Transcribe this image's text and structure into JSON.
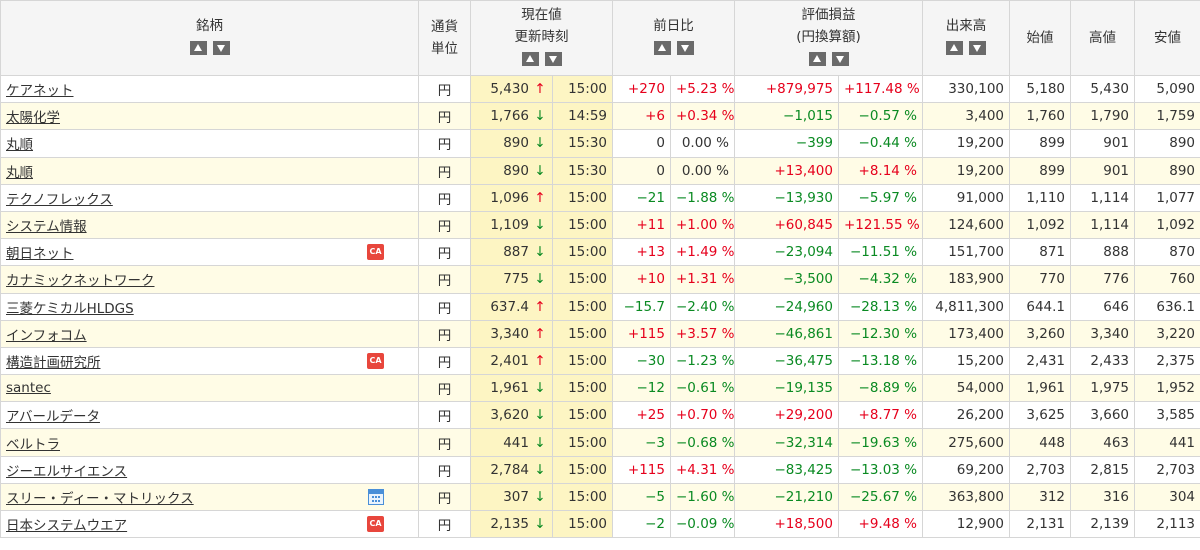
{
  "headers": {
    "name": "銘柄",
    "currency_line1": "通貨",
    "currency_line2": "単位",
    "price_line1": "現在値",
    "price_line2": "更新時刻",
    "change": "前日比",
    "pl_line1": "評価損益",
    "pl_line2": "(円換算額)",
    "volume": "出来高",
    "open": "始値",
    "high": "高値",
    "low": "安値"
  },
  "rows": [
    {
      "name": "ケアネット",
      "badge": "",
      "cur": "円",
      "price": "5,430",
      "arrow": "up",
      "time": "15:00",
      "chg": "+270",
      "chg_pct": "+5.23 %",
      "chg_sign": "pos",
      "pl": "+879,975",
      "pl_pct": "+117.48 %",
      "pl_sign": "pos",
      "volume": "330,100",
      "open": "5,180",
      "high": "5,430",
      "low": "5,090"
    },
    {
      "name": "太陽化学",
      "badge": "",
      "cur": "円",
      "price": "1,766",
      "arrow": "down",
      "time": "14:59",
      "chg": "+6",
      "chg_pct": "+0.34 %",
      "chg_sign": "pos",
      "pl": "−1,015",
      "pl_pct": "−0.57 %",
      "pl_sign": "neg",
      "volume": "3,400",
      "open": "1,760",
      "high": "1,790",
      "low": "1,759"
    },
    {
      "name": "丸順",
      "badge": "",
      "cur": "円",
      "price": "890",
      "arrow": "down",
      "time": "15:30",
      "chg": "0",
      "chg_pct": "0.00 %",
      "chg_sign": "zero",
      "pl": "−399",
      "pl_pct": "−0.44 %",
      "pl_sign": "neg",
      "volume": "19,200",
      "open": "899",
      "high": "901",
      "low": "890"
    },
    {
      "name": "丸順",
      "badge": "",
      "cur": "円",
      "price": "890",
      "arrow": "down",
      "time": "15:30",
      "chg": "0",
      "chg_pct": "0.00 %",
      "chg_sign": "zero",
      "pl": "+13,400",
      "pl_pct": "+8.14 %",
      "pl_sign": "pos",
      "volume": "19,200",
      "open": "899",
      "high": "901",
      "low": "890"
    },
    {
      "name": "テクノフレックス",
      "badge": "",
      "cur": "円",
      "price": "1,096",
      "arrow": "up",
      "time": "15:00",
      "chg": "−21",
      "chg_pct": "−1.88 %",
      "chg_sign": "neg",
      "pl": "−13,930",
      "pl_pct": "−5.97 %",
      "pl_sign": "neg",
      "volume": "91,000",
      "open": "1,110",
      "high": "1,114",
      "low": "1,077"
    },
    {
      "name": "システム情報",
      "badge": "",
      "cur": "円",
      "price": "1,109",
      "arrow": "down",
      "time": "15:00",
      "chg": "+11",
      "chg_pct": "+1.00 %",
      "chg_sign": "pos",
      "pl": "+60,845",
      "pl_pct": "+121.55 %",
      "pl_sign": "pos",
      "volume": "124,600",
      "open": "1,092",
      "high": "1,114",
      "low": "1,092"
    },
    {
      "name": "朝日ネット",
      "badge": "ca",
      "cur": "円",
      "price": "887",
      "arrow": "down",
      "time": "15:00",
      "chg": "+13",
      "chg_pct": "+1.49 %",
      "chg_sign": "pos",
      "pl": "−23,094",
      "pl_pct": "−11.51 %",
      "pl_sign": "neg",
      "volume": "151,700",
      "open": "871",
      "high": "888",
      "low": "870"
    },
    {
      "name": "カナミックネットワーク",
      "badge": "",
      "cur": "円",
      "price": "775",
      "arrow": "down",
      "time": "15:00",
      "chg": "+10",
      "chg_pct": "+1.31 %",
      "chg_sign": "pos",
      "pl": "−3,500",
      "pl_pct": "−4.32 %",
      "pl_sign": "neg",
      "volume": "183,900",
      "open": "770",
      "high": "776",
      "low": "760"
    },
    {
      "name": "三菱ケミカルHLDGS",
      "badge": "",
      "cur": "円",
      "price": "637.4",
      "arrow": "up",
      "time": "15:00",
      "chg": "−15.7",
      "chg_pct": "−2.40 %",
      "chg_sign": "neg",
      "pl": "−24,960",
      "pl_pct": "−28.13 %",
      "pl_sign": "neg",
      "volume": "4,811,300",
      "open": "644.1",
      "high": "646",
      "low": "636.1"
    },
    {
      "name": "インフォコム",
      "badge": "",
      "cur": "円",
      "price": "3,340",
      "arrow": "up",
      "time": "15:00",
      "chg": "+115",
      "chg_pct": "+3.57 %",
      "chg_sign": "pos",
      "pl": "−46,861",
      "pl_pct": "−12.30 %",
      "pl_sign": "neg",
      "volume": "173,400",
      "open": "3,260",
      "high": "3,340",
      "low": "3,220"
    },
    {
      "name": "構造計画研究所",
      "badge": "ca",
      "cur": "円",
      "price": "2,401",
      "arrow": "up",
      "time": "15:00",
      "chg": "−30",
      "chg_pct": "−1.23 %",
      "chg_sign": "neg",
      "pl": "−36,475",
      "pl_pct": "−13.18 %",
      "pl_sign": "neg",
      "volume": "15,200",
      "open": "2,431",
      "high": "2,433",
      "low": "2,375"
    },
    {
      "name": "santec",
      "badge": "",
      "cur": "円",
      "price": "1,961",
      "arrow": "down",
      "time": "15:00",
      "chg": "−12",
      "chg_pct": "−0.61 %",
      "chg_sign": "neg",
      "pl": "−19,135",
      "pl_pct": "−8.89 %",
      "pl_sign": "neg",
      "volume": "54,000",
      "open": "1,961",
      "high": "1,975",
      "low": "1,952"
    },
    {
      "name": "アバールデータ",
      "badge": "",
      "cur": "円",
      "price": "3,620",
      "arrow": "down",
      "time": "15:00",
      "chg": "+25",
      "chg_pct": "+0.70 %",
      "chg_sign": "pos",
      "pl": "+29,200",
      "pl_pct": "+8.77 %",
      "pl_sign": "pos",
      "volume": "26,200",
      "open": "3,625",
      "high": "3,660",
      "low": "3,585"
    },
    {
      "name": "ベルトラ",
      "badge": "",
      "cur": "円",
      "price": "441",
      "arrow": "down",
      "time": "15:00",
      "chg": "−3",
      "chg_pct": "−0.68 %",
      "chg_sign": "neg",
      "pl": "−32,314",
      "pl_pct": "−19.63 %",
      "pl_sign": "neg",
      "volume": "275,600",
      "open": "448",
      "high": "463",
      "low": "441"
    },
    {
      "name": "ジーエルサイエンス",
      "badge": "",
      "cur": "円",
      "price": "2,784",
      "arrow": "down",
      "time": "15:00",
      "chg": "+115",
      "chg_pct": "+4.31 %",
      "chg_sign": "pos",
      "pl": "−83,425",
      "pl_pct": "−13.03 %",
      "pl_sign": "neg",
      "volume": "69,200",
      "open": "2,703",
      "high": "2,815",
      "low": "2,703"
    },
    {
      "name": "スリー・ディー・マトリックス",
      "badge": "cal",
      "cur": "円",
      "price": "307",
      "arrow": "down",
      "time": "15:00",
      "chg": "−5",
      "chg_pct": "−1.60 %",
      "chg_sign": "neg",
      "pl": "−21,210",
      "pl_pct": "−25.67 %",
      "pl_sign": "neg",
      "volume": "363,800",
      "open": "312",
      "high": "316",
      "low": "304"
    },
    {
      "name": "日本システムウエア",
      "badge": "ca",
      "cur": "円",
      "price": "2,135",
      "arrow": "down",
      "time": "15:00",
      "chg": "−2",
      "chg_pct": "−0.09 %",
      "chg_sign": "neg",
      "pl": "+18,500",
      "pl_pct": "+9.48 %",
      "pl_sign": "pos",
      "volume": "12,900",
      "open": "2,131",
      "high": "2,139",
      "low": "2,113"
    }
  ],
  "glyphs": {
    "up": "↑",
    "down": "↓",
    "ca": "CA"
  }
}
